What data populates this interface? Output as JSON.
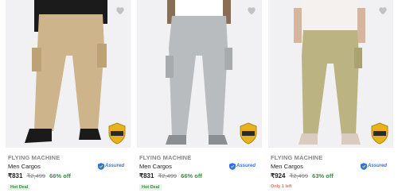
{
  "products": [
    {
      "brand": "FLYING MACHINE",
      "title": "Men Cargos",
      "price": "₹831",
      "mrp": "₹2,499",
      "discount": "66% off",
      "tag": "Hot Deal",
      "assured": "Assured",
      "pant_color": "#cdb48a"
    },
    {
      "brand": "FLYING MACHINE",
      "title": "Men Cargos",
      "price": "₹831",
      "mrp": "₹2,499",
      "discount": "66% off",
      "tag": "Hot Deal",
      "assured": "Assured",
      "pant_color": "#b9bcbf"
    },
    {
      "brand": "FLYING MACHINE",
      "title": "Men Cargos",
      "price": "₹924",
      "mrp": "₹2,499",
      "discount": "63% off",
      "tag": "Only 1 left",
      "assured": "Assured",
      "pant_color": "#bcb383"
    }
  ]
}
